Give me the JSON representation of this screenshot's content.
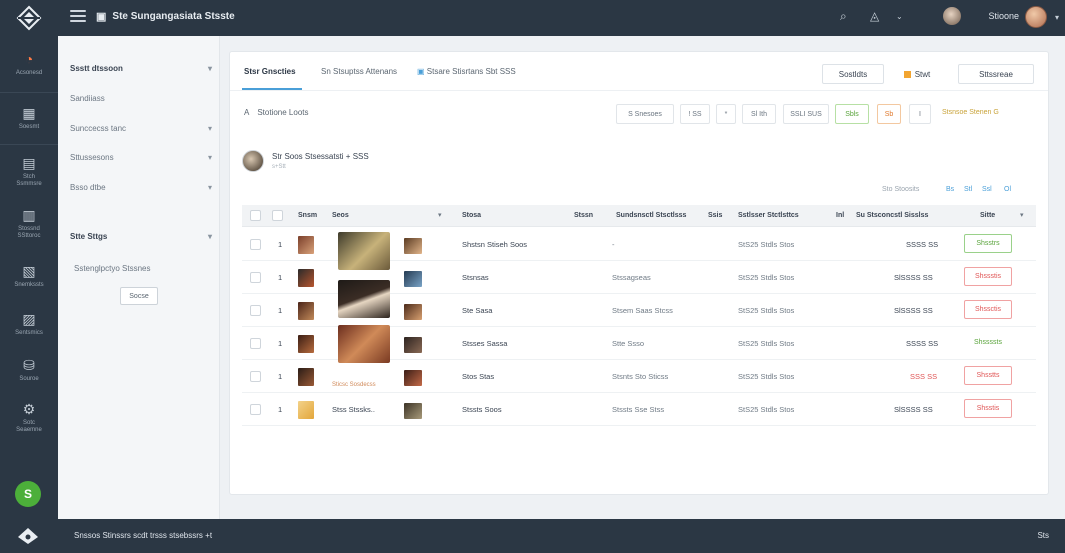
{
  "topbar": {
    "title": "Ste Sungangasiata Stsste",
    "user_name": "Stioone"
  },
  "rail": {
    "items": [
      {
        "label": "Acsonesd"
      },
      {
        "label": "Soesmt"
      },
      {
        "label": "Stch\nSsmmsre"
      },
      {
        "label": "Stossnd\nSSttoroc"
      },
      {
        "label": "Snemkssts"
      },
      {
        "label": "Sentsmics"
      },
      {
        "label": "Souroe"
      },
      {
        "label": "Sotc\nSeaemne"
      }
    ],
    "badge": "S"
  },
  "subnav": {
    "section1": "Ssstt dtssoon",
    "items": [
      "Sandiiass",
      "Sunccecss tanc",
      "Sttussesons",
      "Bsso dtbe"
    ],
    "section2": "Stte Sttgs",
    "note": "Sstenglpctyo Stssnes",
    "button": "Socse"
  },
  "tabs": [
    "Stsr Gnscties",
    "Sn Stsuptss Attenans",
    "Stsare Stisrtans Sbt SSS"
  ],
  "header_buttons": {
    "primary": "Sostldts",
    "secondary": "Stwt",
    "tertiary": "Sttssreae"
  },
  "search": {
    "icon": "A",
    "label": "Stotione Loots"
  },
  "toolbar": {
    "items": [
      "S Snesoes",
      "! SS",
      "*",
      "Sl Ith",
      "SSLI SUS",
      "Sbls",
      "Sb",
      "I"
    ],
    "link": "Stsnsoe Stenen G"
  },
  "store": {
    "name": "Str Soos Stsessatsti + SSS",
    "sub": "s+Stt"
  },
  "meta": {
    "label": "Sto Stoosits",
    "pages": [
      "Bs",
      "Stl",
      "Ssl",
      "Ol"
    ]
  },
  "table": {
    "columns": [
      "Snsm",
      "Seos",
      "Stosa",
      "Stssn",
      "Sundsnsctl Stsctlsss",
      "Ssis",
      "Sstlsser Stctlsttcs",
      "Inl",
      "Su Stsconcstl Sisslss",
      "Sitte"
    ],
    "rows": [
      {
        "idx": "1",
        "name": "",
        "product": "Shstsn Stiseh Soos",
        "category": "-",
        "date": "StS25 Stdls Stos",
        "price": "SSSS SS",
        "status": "Shsstrs",
        "status_type": "ok"
      },
      {
        "idx": "1",
        "name": "",
        "product": "Stsnsas",
        "category": "Stssagseas",
        "date": "StS25 Stdls Stos",
        "price": "SlSSSS SS",
        "status": "Shssstis",
        "status_type": "bad"
      },
      {
        "idx": "1",
        "name": "",
        "product": "Ste Sasa",
        "category": "Stsem Saas Stcss",
        "date": "StS25 Stdls Stos",
        "price": "SlSSSS SS",
        "status": "Shssctis",
        "status_type": "bad"
      },
      {
        "idx": "1",
        "name": "",
        "product": "Stsses Sassa",
        "category": "Stte Ssso",
        "date": "StS25 Stdls Stos",
        "price": "SSSS SS",
        "status": "Shssssts",
        "status_type": "plain"
      },
      {
        "idx": "1",
        "name": "",
        "product": "Stos Stas",
        "category": "Stsnts Sto Sticss",
        "date": "StS25 Stdls Stos",
        "price": "SSS SS",
        "status": "Shsstts",
        "status_type": "bad"
      },
      {
        "idx": "1",
        "name": "Stss Stssks..",
        "product": "Stssts Soos",
        "category": "Stssts Sse Stss",
        "date": "StS25 Stdls Stos",
        "price": "SlSSSS SS",
        "status": "Shsstis",
        "status_type": "bad"
      }
    ],
    "caption": "Sticsc Sosdecss"
  },
  "bottombar": {
    "text": "Snssos Stinssrs scdt trsss stsebssrs +t",
    "right": "Sts"
  }
}
